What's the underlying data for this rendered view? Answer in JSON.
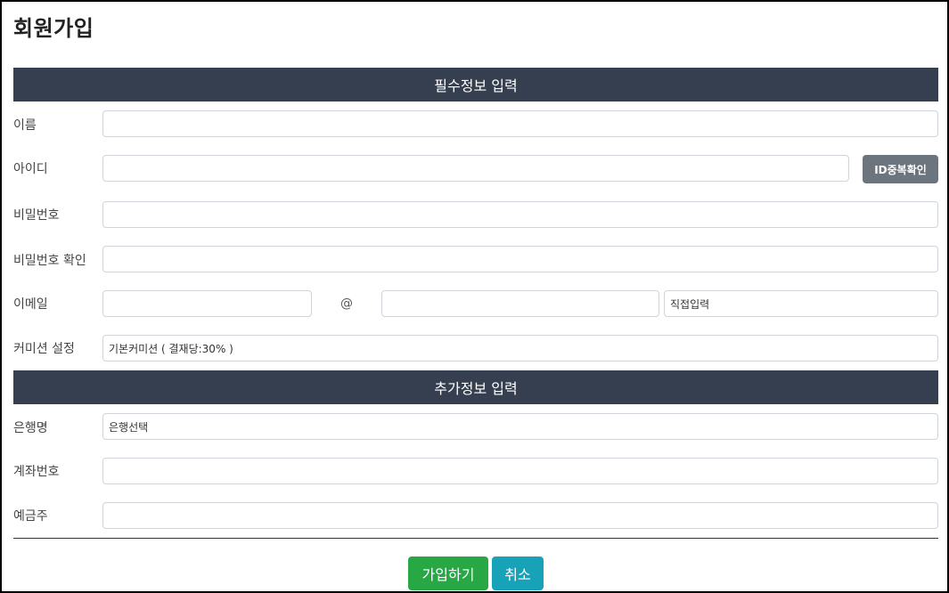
{
  "page": {
    "title": "회원가입"
  },
  "required_section": {
    "title": "필수정보 입력"
  },
  "optional_section": {
    "title": "추가정보 입력"
  },
  "fields": {
    "name": {
      "label": "이름",
      "value": ""
    },
    "userid": {
      "label": "아이디",
      "value": ""
    },
    "dup_check_button": "ID중복확인",
    "password": {
      "label": "비밀번호",
      "value": ""
    },
    "password_confirm": {
      "label": "비밀번호 확인",
      "value": ""
    },
    "email": {
      "label": "이메일",
      "local_value": "",
      "at_sign": "@",
      "domain_value": "",
      "domain_select": "직접입력"
    },
    "commission": {
      "label": "커미션 설정",
      "select": "기본커미션 ( 결재당:30% )"
    },
    "bank": {
      "label": "은행명",
      "select": "은행선택"
    },
    "account": {
      "label": "계좌번호",
      "value": ""
    },
    "holder": {
      "label": "예금주",
      "value": ""
    }
  },
  "actions": {
    "join": "가입하기",
    "cancel": "취소"
  }
}
